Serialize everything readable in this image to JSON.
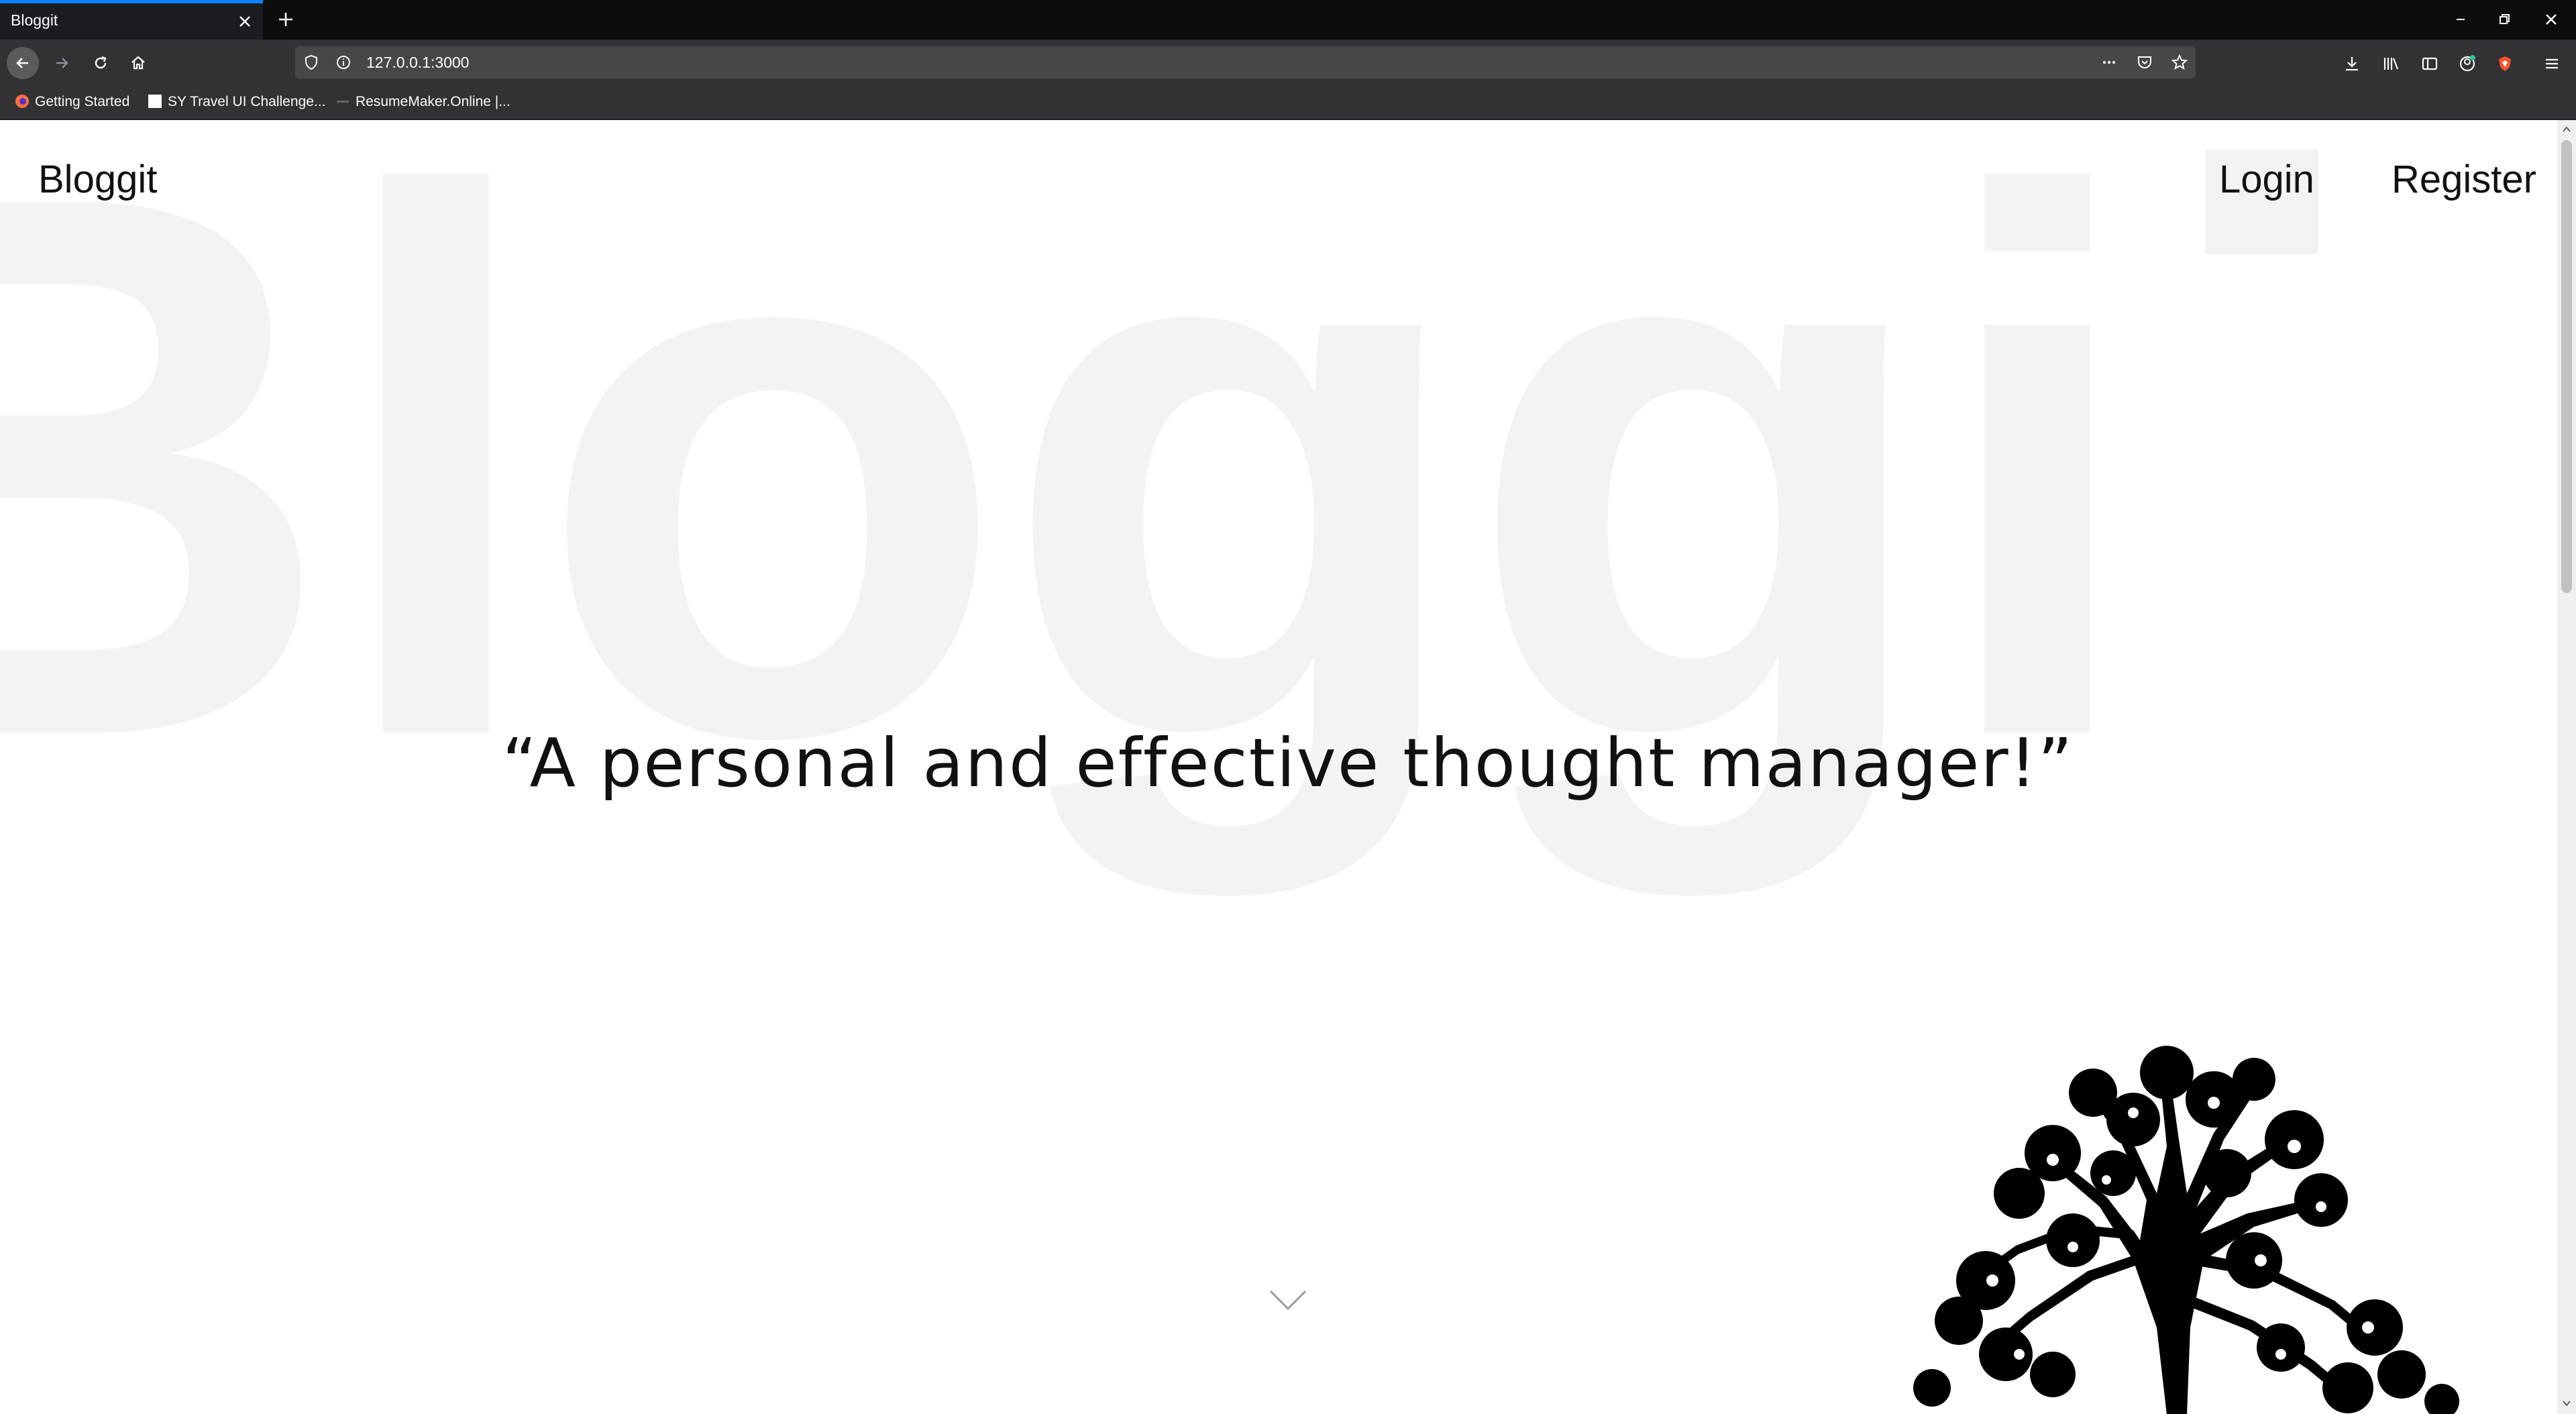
{
  "browser": {
    "tab_title": "Bloggit",
    "url": "127.0.0.1:3000",
    "bookmarks": [
      {
        "label": "Getting Started",
        "icon": "firefox-icon"
      },
      {
        "label": "SY Travel UI Challenge...",
        "icon": "page-icon"
      },
      {
        "label": "ResumeMaker.Online |...",
        "icon": "dash-icon"
      }
    ],
    "accent_color": "#0a84ff"
  },
  "page": {
    "background_word": "Bloggi",
    "brand": "Bloggit",
    "nav": {
      "login": "Login",
      "register": "Register"
    },
    "tagline": "“A personal and effective thought manager!”"
  }
}
